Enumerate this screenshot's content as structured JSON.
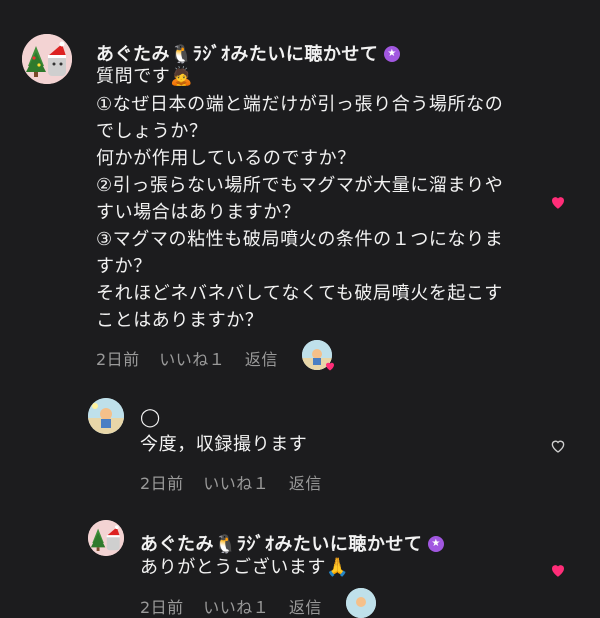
{
  "colors": {
    "background": "#1c1c1e",
    "text": "#f2f2f2",
    "muted": "#9a9a9a",
    "heart_pink": "#ff2d78",
    "verified": "#a157e0"
  },
  "comments": [
    {
      "author": "あぐたみ🐧ﾗｼﾞｵみたいに聴かせて",
      "avatar_icon": "christmas-avatar-icon",
      "lines": [
        "質問です🙇",
        "①なぜ日本の端と端だけが引っ張り合う場所なの",
        "でしょうか？",
        "何かが作用しているのですか？",
        "②引っ張らない場所でもマグマが大量に溜まりや",
        "すい場合はありますか？",
        "③マグマの粘性も破局噴火の条件の１つになりま",
        "すか？",
        "それほどネバネバしてなくても破局噴火を起こす",
        "ことはありますか？"
      ],
      "date": "2日前",
      "likes": "いいね１",
      "reply": "返信",
      "heart": "heart-filled-icon"
    },
    {
      "author": "",
      "avatar_icon": "beach-avatar-icon",
      "lines": [
        "◯",
        "今度，収録撮ります"
      ],
      "date": "2日前",
      "likes": "いいね１",
      "reply": "返信",
      "heart": "heart-outline-icon"
    },
    {
      "author": "あぐたみ🐧ﾗｼﾞｵみたいに聴かせて",
      "avatar_icon": "christmas-avatar-icon",
      "lines": [
        "ありがとうございます🙏"
      ],
      "date": "2日前",
      "likes": "いいね１",
      "reply": "返信",
      "heart": "heart-filled-icon"
    }
  ]
}
